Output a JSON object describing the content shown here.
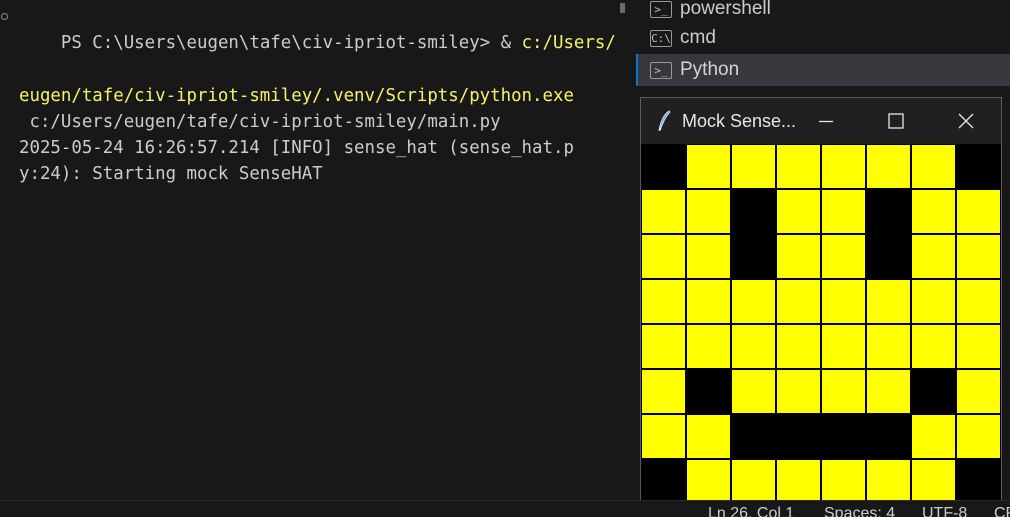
{
  "terminal": {
    "line1_prefix": "PS C:\\Users\\eugen\\tafe\\civ-ipriot-smiley> & ",
    "line1_path": "c:/Users/",
    "line2_path": "eugen/tafe/civ-ipriot-smiley/.venv/Scripts/python.exe",
    "line3": " c:/Users/eugen/tafe/civ-ipriot-smiley/main.py",
    "line4": "2025-05-24 16:26:57.214 [INFO] sense_hat (sense_hat.p",
    "line5": "y:24): Starting mock SenseHAT"
  },
  "terminal_list": {
    "items": [
      {
        "label": "powershell",
        "icon": "terminal-icon"
      },
      {
        "label": "cmd",
        "icon": "cmd-icon"
      },
      {
        "label": "Python",
        "icon": "terminal-icon"
      }
    ],
    "active_index": 2
  },
  "mock_window": {
    "title": "Mock Sense...",
    "icon": "feather-icon",
    "min_icon": "minimize-icon",
    "max_icon": "maximize-icon",
    "close_icon": "close-icon",
    "colors": {
      "on": "#ffff00",
      "off": "#000000"
    },
    "pixels": [
      [
        0,
        1,
        1,
        1,
        1,
        1,
        1,
        0
      ],
      [
        1,
        1,
        0,
        1,
        1,
        0,
        1,
        1
      ],
      [
        1,
        1,
        0,
        1,
        1,
        0,
        1,
        1
      ],
      [
        1,
        1,
        1,
        1,
        1,
        1,
        1,
        1
      ],
      [
        1,
        1,
        1,
        1,
        1,
        1,
        1,
        1
      ],
      [
        1,
        0,
        1,
        1,
        1,
        1,
        0,
        1
      ],
      [
        1,
        1,
        0,
        0,
        0,
        0,
        1,
        1
      ],
      [
        0,
        1,
        1,
        1,
        1,
        1,
        1,
        0
      ]
    ]
  },
  "statusbar": {
    "position": "Ln 26, Col 1",
    "spaces": "Spaces: 4",
    "encoding": "UTF-8",
    "eol": "CR"
  }
}
